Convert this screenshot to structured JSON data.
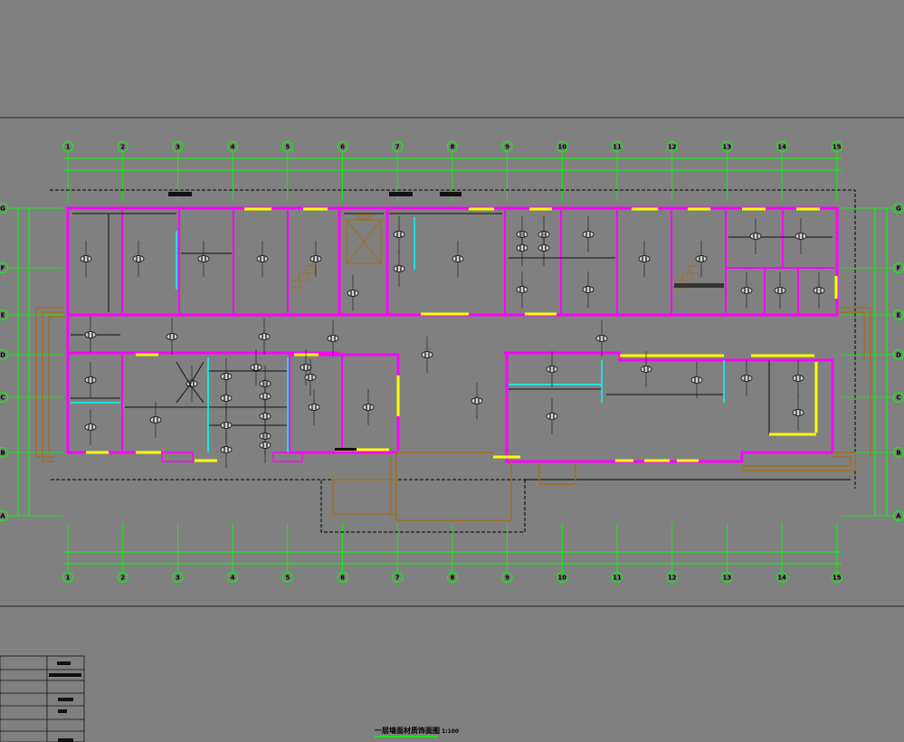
{
  "drawing": {
    "title": "一层墙面材质饰面图",
    "scale": "1:100",
    "colors": {
      "background": "#808080",
      "grid": "#00ff00",
      "wall": "#ff00ff",
      "partition": "#000000",
      "door": "#ffff00",
      "glass": "#00ffff",
      "stair": "#a07020",
      "frame": "#000000"
    }
  },
  "grid_axes": {
    "columns": [
      "1",
      "2",
      "3",
      "4",
      "5",
      "6",
      "7",
      "8",
      "9",
      "10",
      "11",
      "12",
      "13",
      "14",
      "15"
    ],
    "rows": [
      "G",
      "F",
      "E",
      "D",
      "C",
      "B",
      "A"
    ]
  },
  "icons": {
    "fixture": "ceiling-light-icon",
    "elevator": "elevator-shaft-icon",
    "stairs": "staircase-icon"
  }
}
